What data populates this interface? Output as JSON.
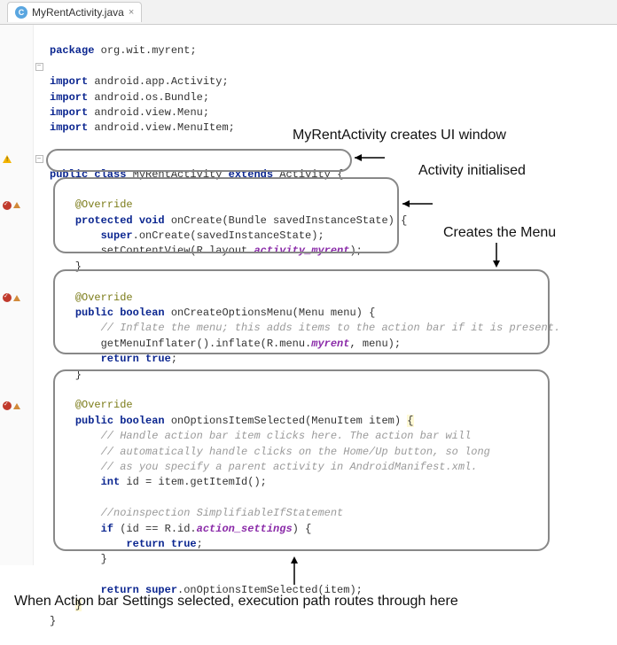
{
  "tab": {
    "icon_letter": "C",
    "filename": "MyRentActivity.java",
    "close_glyph": "×"
  },
  "callouts": {
    "creates_window": "MyRentActivity creates UI window",
    "activity_init": "Activity initialised",
    "creates_menu": "Creates the Menu",
    "bottom": "When Action bar Settings selected, execution path routes through here"
  },
  "code": {
    "l1_pkg": "package",
    "l1_rest": " org.wit.myrent;",
    "imp": "import",
    "i1": " android.app.Activity;",
    "i2": " android.os.Bundle;",
    "i3": " android.view.Menu;",
    "i4": " android.view.MenuItem;",
    "cls_public": "public class",
    "cls_name": " MyRentActivity ",
    "cls_ext": "extends",
    "cls_sup": " Activity {",
    "ov": "@Override",
    "m1_sig_a": "protected void",
    "m1_sig_b": " onCreate(Bundle savedInstanceState) {",
    "m1_l1a": "super",
    "m1_l1b": ".onCreate(savedInstanceState);",
    "m1_l2a": "setContentView(R.layout.",
    "m1_l2b": "activity_myrent",
    "m1_l2c": ");",
    "m2_sig_a": "public boolean",
    "m2_sig_b": " onCreateOptionsMenu(Menu menu) {",
    "m2_c1": "// Inflate the menu; this adds items to the action bar if it is present.",
    "m2_l1a": "getMenuInflater().inflate(R.menu.",
    "m2_l1b": "myrent",
    "m2_l1c": ", menu);",
    "m2_ret": "return true",
    "semi": ";",
    "m3_sig_a": "public boolean",
    "m3_sig_b": " onOptionsItemSelected(MenuItem item) ",
    "m3_brace": "{",
    "m3_c1": "// Handle action bar item clicks here. The action bar will",
    "m3_c2": "// automatically handle clicks on the Home/Up button, so long",
    "m3_c3": "// as you specify a parent activity in AndroidManifest.xml.",
    "m3_l1a": "int",
    "m3_l1b": " id = item.getItemId();",
    "m3_c4": "//noinspection SimplifiableIfStatement",
    "m3_l2a": "if",
    "m3_l2b": " (id == R.id.",
    "m3_l2c": "action_settings",
    "m3_l2d": ") {",
    "m3_ret1": "return true",
    "m3_cb": "}",
    "m3_ret2a": "return super",
    "m3_ret2b": ".onOptionsItemSelected(item);",
    "m3_close": "}",
    "cls_close": "}"
  }
}
